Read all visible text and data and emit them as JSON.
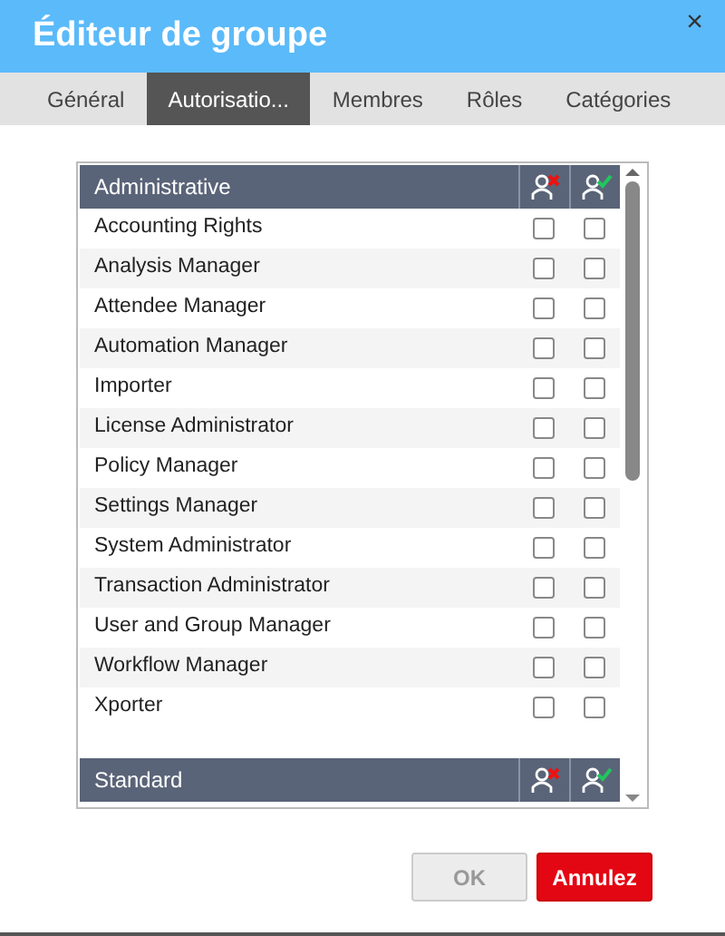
{
  "window": {
    "title": "Éditeur de groupe",
    "close": "×"
  },
  "tabs": [
    {
      "label": "Général",
      "selected": false
    },
    {
      "label": "Autorisatio...",
      "selected": true
    },
    {
      "label": "Membres",
      "selected": false
    },
    {
      "label": "Rôles",
      "selected": false
    },
    {
      "label": "Catégories",
      "selected": false
    }
  ],
  "sections": [
    {
      "title": "Administrative",
      "rows": [
        {
          "name": "Accounting Rights",
          "deny": false,
          "allow": false
        },
        {
          "name": "Analysis Manager",
          "deny": false,
          "allow": false
        },
        {
          "name": "Attendee Manager",
          "deny": false,
          "allow": false
        },
        {
          "name": "Automation Manager",
          "deny": false,
          "allow": false
        },
        {
          "name": "Importer",
          "deny": false,
          "allow": false
        },
        {
          "name": "License Administrator",
          "deny": false,
          "allow": false
        },
        {
          "name": "Policy Manager",
          "deny": false,
          "allow": false
        },
        {
          "name": "Settings Manager",
          "deny": false,
          "allow": false
        },
        {
          "name": "System Administrator",
          "deny": false,
          "allow": false
        },
        {
          "name": "Transaction Administrator",
          "deny": false,
          "allow": false
        },
        {
          "name": "User and Group Manager",
          "deny": false,
          "allow": false
        },
        {
          "name": "Workflow Manager",
          "deny": false,
          "allow": false
        },
        {
          "name": "Xporter",
          "deny": false,
          "allow": false
        }
      ]
    },
    {
      "title": "Standard"
    }
  ],
  "buttons": [
    {
      "label": "OK",
      "kind": "secondary",
      "disabled": true
    },
    {
      "label": "Annulez",
      "kind": "primary",
      "disabled": false
    }
  ]
}
